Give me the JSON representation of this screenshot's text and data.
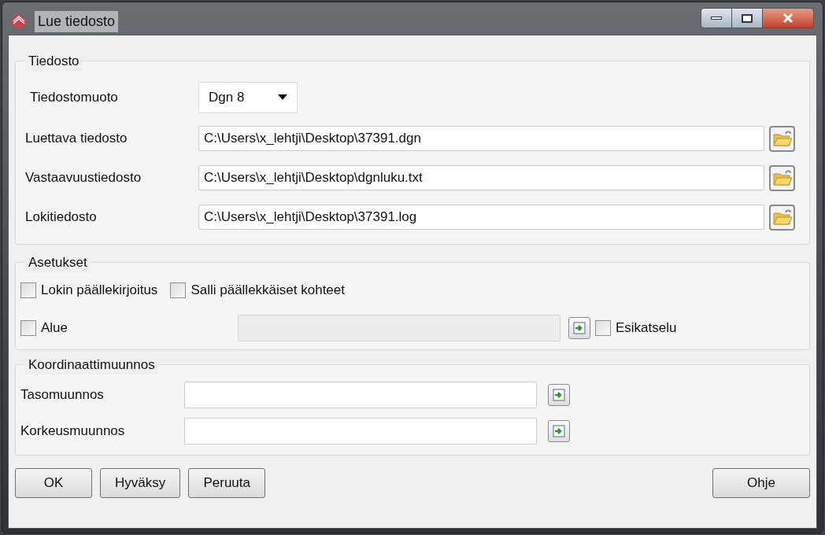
{
  "window": {
    "title": "Lue tiedosto"
  },
  "file_group": {
    "title": "Tiedosto",
    "format": {
      "label": "Tiedostomuoto",
      "value": "Dgn 8"
    },
    "rows": [
      {
        "label": "Luettava tiedosto",
        "value": "C:\\Users\\x_lehtji\\Desktop\\37391.dgn"
      },
      {
        "label": "Vastaavuustiedosto",
        "value": "C:\\Users\\x_lehtji\\Desktop\\dgnluku.txt"
      },
      {
        "label": "Lokitiedosto",
        "value": "C:\\Users\\x_lehtji\\Desktop\\37391.log"
      }
    ]
  },
  "settings_group": {
    "title": "Asetukset",
    "options": [
      {
        "label": "Lokin päällekirjoitus",
        "checked": false
      },
      {
        "label": "Salli päällekkäiset kohteet",
        "checked": false
      }
    ],
    "area": {
      "label": "Alue",
      "checked": false
    },
    "preview": {
      "label": "Esikatselu",
      "checked": false
    }
  },
  "transform_group": {
    "title": "Koordinaattimuunnos",
    "rows": [
      {
        "label": "Tasomuunnos"
      },
      {
        "label": "Korkeusmuunnos"
      }
    ]
  },
  "buttons": [
    {
      "label": "OK"
    },
    {
      "label": "Hyväksy"
    },
    {
      "label": "Peruuta"
    }
  ],
  "help_button": {
    "label": "Ohje"
  }
}
